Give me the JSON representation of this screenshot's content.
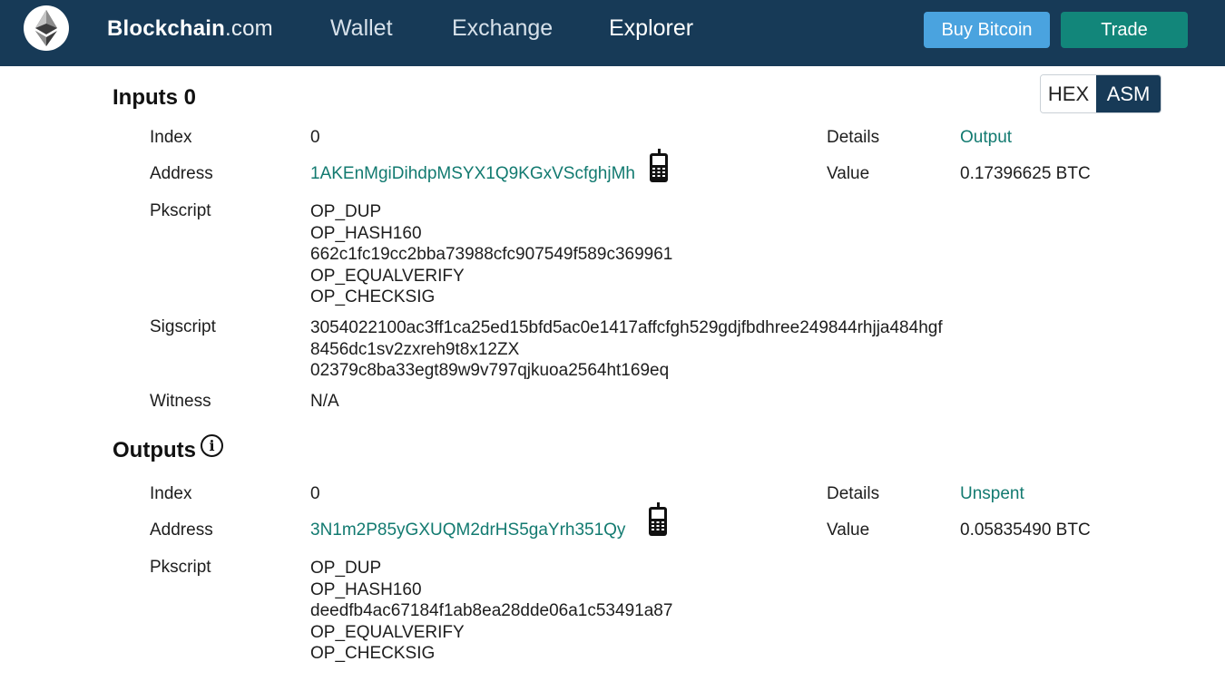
{
  "header": {
    "brand_bold": "Blockchain",
    "brand_suffix": ".com",
    "nav": [
      "Wallet",
      "Exchange",
      "Explorer"
    ],
    "buy_label": "Buy Bitcoin",
    "trade_label": "Trade"
  },
  "toggle": {
    "hex": "HEX",
    "asm": "ASM",
    "selected": "ASM"
  },
  "inputs": {
    "title": "Inputs 0",
    "labels": {
      "index": "Index",
      "address": "Address",
      "pkscript": "Pkscript",
      "sigscript": "Sigscript",
      "witness": "Witness",
      "details": "Details",
      "value": "Value"
    },
    "index": "0",
    "address": "1AKEnMgiDihdpMSYX1Q9KGxVScfghjMh",
    "details": "Output",
    "value": "0.17396625 BTC",
    "pkscript": [
      "OP_DUP",
      "OP_HASH160",
      "662c1fc19cc2bba73988cfc907549f589c369961",
      "OP_EQUALVERIFY",
      "OP_CHECKSIG"
    ],
    "sigscript": [
      "3054022100ac3ff1ca25ed15bfd5ac0e1417affcfgh529gdjfbdhree249844rhjja484hgf",
      "8456dc1sv2zxreh9t8x12ZX",
      "02379c8ba33egt89w9v797qjkuoa2564ht169eq"
    ],
    "witness": "N/A"
  },
  "outputs": {
    "title": "Outputs",
    "labels": {
      "index": "Index",
      "address": "Address",
      "pkscript": "Pkscript",
      "details": "Details",
      "value": "Value"
    },
    "index": "0",
    "address": "3N1m2P85yGXUQM2drHS5gaYrh351Qy",
    "details": "Unspent",
    "value": "0.05835490 BTC",
    "pkscript": [
      "OP_DUP",
      "OP_HASH160",
      "deedfb4ac67184f1ab8ea28dde06a1c53491a87",
      "OP_EQUALVERIFY",
      "OP_CHECKSIG"
    ]
  },
  "colors": {
    "navbar": "#173a57",
    "buy": "#4aa3df",
    "trade": "#12867a",
    "link": "#127a70"
  },
  "icons": [
    "ethereum-logo-icon",
    "phone-icon",
    "info-icon"
  ]
}
